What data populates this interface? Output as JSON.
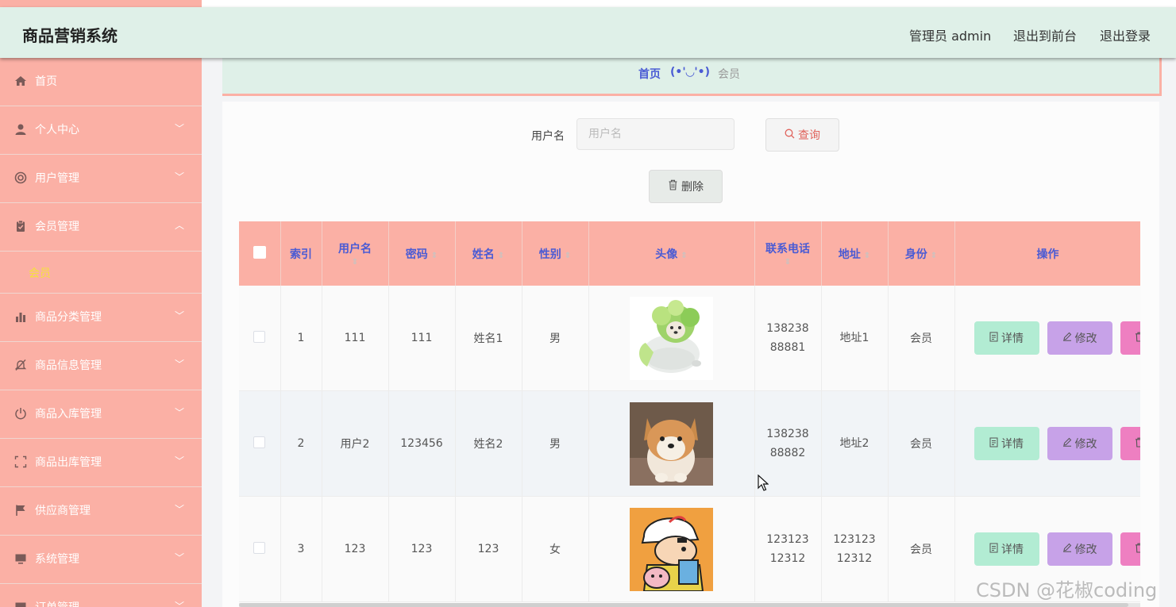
{
  "app": {
    "title": "商品营销系统",
    "admin_label": "管理员 admin",
    "front_link": "退出到前台",
    "logout_link": "退出登录"
  },
  "sidebar": {
    "items": [
      {
        "label": "首页",
        "icon": "home-icon"
      },
      {
        "label": "个人中心",
        "icon": "user-icon",
        "arrow": "﹀"
      },
      {
        "label": "用户管理",
        "icon": "lifebuoy-icon",
        "arrow": "﹀"
      },
      {
        "label": "会员管理",
        "icon": "clipboard-icon",
        "arrow": "︿"
      },
      {
        "label": "商品分类管理",
        "icon": "bar-chart-icon",
        "arrow": "﹀"
      },
      {
        "label": "商品信息管理",
        "icon": "bell-off-icon",
        "arrow": "﹀"
      },
      {
        "label": "商品入库管理",
        "icon": "power-icon",
        "arrow": "﹀"
      },
      {
        "label": "商品出库管理",
        "icon": "fullscreen-icon",
        "arrow": "﹀"
      },
      {
        "label": "供应商管理",
        "icon": "flag-icon",
        "arrow": "﹀"
      },
      {
        "label": "系统管理",
        "icon": "monitor-icon",
        "arrow": "﹀"
      },
      {
        "label": "订单管理",
        "icon": "monitor-icon",
        "arrow": "﹀"
      }
    ],
    "submenu_label": "会员"
  },
  "breadcrumb": {
    "home": "首页",
    "face": "(•'◡'•)",
    "current": "会员"
  },
  "search": {
    "label": "用户名",
    "placeholder": "用户名",
    "query_button": "查询",
    "delete_button": "删除"
  },
  "table": {
    "columns": [
      "索引",
      "用户名",
      "密码",
      "姓名",
      "性别",
      "头像",
      "联系电话",
      "地址",
      "身份",
      "操作"
    ],
    "rows": [
      {
        "index": "1",
        "username": "111",
        "password": "111",
        "name": "姓名1",
        "gender": "男",
        "phone": "13823888881",
        "address": "地址1",
        "role": "会员",
        "avatar": "cabbage-dog"
      },
      {
        "index": "2",
        "username": "用户2",
        "password": "123456",
        "name": "姓名2",
        "gender": "男",
        "phone": "13823888882",
        "address": "地址2",
        "role": "会员",
        "avatar": "shiba-dog"
      },
      {
        "index": "3",
        "username": "123",
        "password": "123",
        "name": "123",
        "gender": "女",
        "phone": "12312312312",
        "address": "12312312312",
        "role": "会员",
        "avatar": "cartoon-boy"
      }
    ],
    "actions": {
      "detail": "详情",
      "edit": "修改"
    }
  },
  "watermark": "CSDN @花椒coding",
  "colors": {
    "sidebar": "#fbb0a5",
    "header": "#dff0e8",
    "accent_blue": "#4a5bd4",
    "detail_btn": "#b2ecd3",
    "edit_btn": "#c7a2e8",
    "delete_btn": "#ee7fc1",
    "submenu_active": "#f5e23c"
  }
}
